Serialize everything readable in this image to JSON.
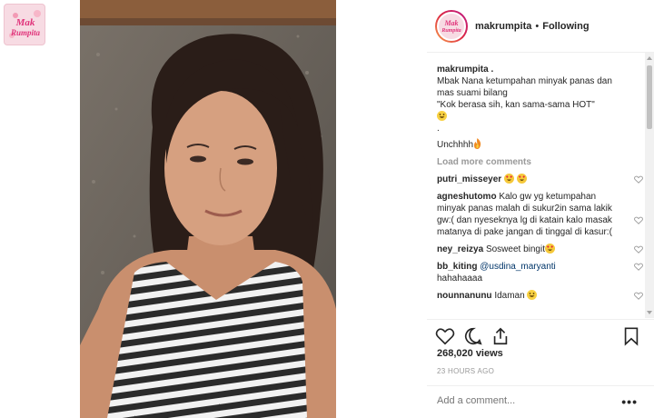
{
  "brand": {
    "logo_text": "Mak\nRumpita",
    "logo_line1": "Mak",
    "logo_line2": "Rumpita"
  },
  "header": {
    "username": "makrumpita",
    "separator": "•",
    "follow_status": "Following"
  },
  "caption": {
    "username": "makrumpita .",
    "lines": [
      "Mbak Nana ketumpahan minyak panas dan",
      "mas suami bilang",
      "\"Kok berasa sih, kan sama-sama HOT\"",
      ".",
      "Unchhhh"
    ]
  },
  "load_more_label": "Load more comments",
  "comments": [
    {
      "username": "putri_misseyer",
      "text": ""
    },
    {
      "username": "agneshutomo",
      "text": "Kalo gw yg ketumpahan minyak panas malah di sukur2in sama lakik gw:( dan nyeseknya lg di katain kalo masak matanya di pake jangan di tinggal di kasur:("
    },
    {
      "username": "ney_reizya",
      "text": "Sosweet bingit"
    },
    {
      "username": "bb_kiting",
      "mention": "@usdina_maryanti",
      "text": "hahahaaaa"
    },
    {
      "username": "nounnanunu",
      "text": "Idaman"
    }
  ],
  "views_text": "268,020 views",
  "timestamp": "23 HOURS AGO",
  "add_comment_placeholder": "Add a comment...",
  "more_label": "•••",
  "icons": [
    "heart-icon",
    "comment-icon",
    "share-icon",
    "bookmark-icon",
    "fire-emoji",
    "heart-eyes-emoji",
    "grin-emoji"
  ],
  "colors": {
    "accent_gradient": [
      "#f9a24a",
      "#dc2743",
      "#bc1888"
    ],
    "muted": "#999999",
    "link": "#003569"
  }
}
